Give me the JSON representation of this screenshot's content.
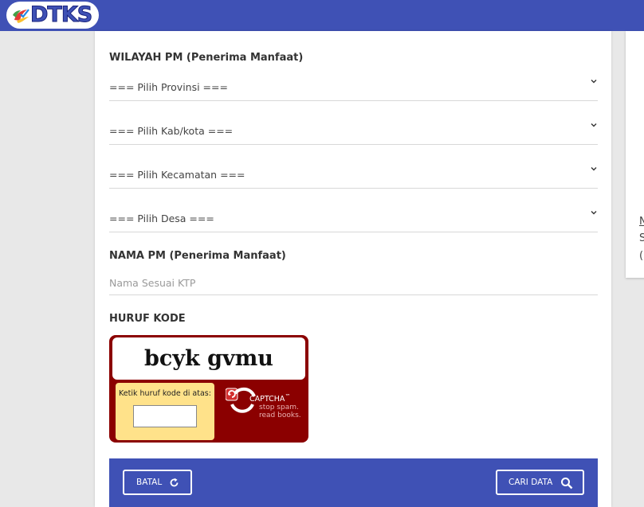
{
  "header": {
    "logo_text": "DTKS",
    "brand_color": "#3f51b5"
  },
  "form": {
    "wilayah_label": "WILAYAH PM (Penerima Manfaat)",
    "provinsi_select": "=== Pilih Provinsi ===",
    "kabkota_select": "=== Pilih Kab/kota ===",
    "kecamatan_select": "=== Pilih Kecamatan ===",
    "desa_select": "=== Pilih Desa ===",
    "nama_label": "NAMA PM (Penerima Manfaat)",
    "nama_placeholder": "Nama Sesuai KTP",
    "nama_value": "",
    "kode_label": "HURUF KODE"
  },
  "captcha": {
    "word": "bcyk gvmu",
    "entry_label": "Ketik huruf kode di atas:",
    "entry_value": "",
    "brand": "CAPTCHA",
    "tm": "™",
    "tagline_1": "stop spam.",
    "tagline_2": "read books.",
    "bg_color": "#8b0000",
    "entry_bg_color": "#ffe28a"
  },
  "actions": {
    "batal_label": "BATAL",
    "batal_icon": "refresh-icon",
    "cari_label": "CARI DATA",
    "cari_icon": "search-icon"
  },
  "side_panel": {
    "line_1": "N",
    "line_2": "S",
    "line_3": "("
  }
}
